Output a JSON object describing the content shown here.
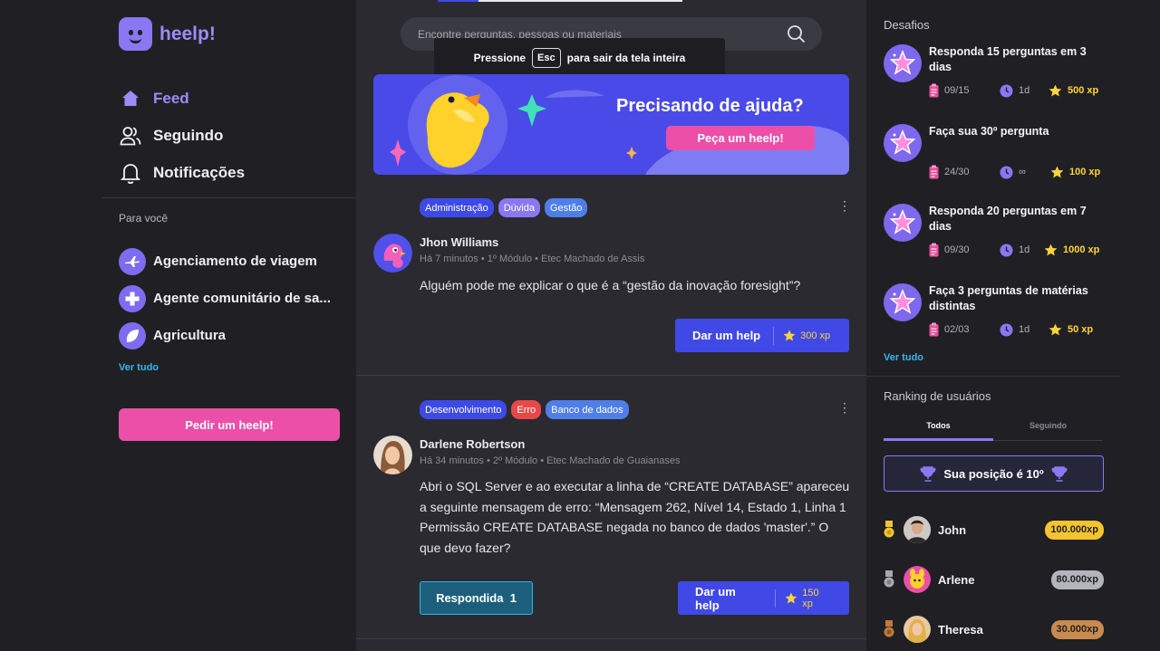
{
  "app": {
    "logo_text": "heelp!"
  },
  "nav": [
    {
      "label": "Feed",
      "icon": "home-icon",
      "active": true
    },
    {
      "label": "Seguindo",
      "icon": "users-icon",
      "active": false
    },
    {
      "label": "Notificações",
      "icon": "bell-icon",
      "active": false
    }
  ],
  "for_you": {
    "title": "Para você",
    "topics": [
      {
        "label": "Agenciamento de viagem",
        "icon": "airplane-icon"
      },
      {
        "label": "Agente comunitário de sa...",
        "icon": "health-cross-icon"
      },
      {
        "label": "Agricultura",
        "icon": "leaf-icon"
      }
    ],
    "see_all": "Ver tudo"
  },
  "ask_button": "Pedir um heelp!",
  "search": {
    "placeholder": "Encontre perguntas, pessoas ou materiais"
  },
  "fullscreen_toast": {
    "before": "Pressione",
    "key": "Esc",
    "after": "para sair da tela inteira"
  },
  "banner": {
    "title": "Precisando de ajuda?",
    "button": "Peça um heelp!"
  },
  "posts": [
    {
      "tags": [
        {
          "label": "Administração",
          "color": "#3d4ae8"
        },
        {
          "label": "Dúvida",
          "color": "#8a78f2"
        },
        {
          "label": "Gestão",
          "color": "#4f7ee8"
        }
      ],
      "author": "Jhon Williams",
      "meta": "Há 7 minutos • 1º Módulo • Etec Machado de Assis",
      "body": "Alguém pode me explicar o que é a “gestão da inovação foresight”?",
      "help_label": "Dar um help",
      "xp": "300 xp"
    },
    {
      "tags": [
        {
          "label": "Desenvolvimento",
          "color": "#3d4ae8"
        },
        {
          "label": "Erro",
          "color": "#e84848"
        },
        {
          "label": "Banco de dados",
          "color": "#4f7ee8"
        }
      ],
      "author": "Darlene Robertson",
      "meta": "Há 34 minutos • 2º Módulo • Etec Machado de Guaianases",
      "body": "Abri o SQL Server e ao executar a linha de “CREATE DATABASE” apareceu a seguinte mensagem de erro:  “Mensagem 262, Nível 14, Estado 1, Linha 1 Permissão CREATE DATABASE negada no banco de dados 'master'.” O que devo fazer?",
      "answered_label": "Respondida",
      "answered_count": "1",
      "help_label": "Dar um help",
      "xp": "150 xp"
    }
  ],
  "challenges": {
    "title": "Desafios",
    "items": [
      {
        "name": "Responda 15 perguntas em 3 dias",
        "progress": "09/15",
        "time": "1d",
        "xp": "500 xp"
      },
      {
        "name": "Faça sua 30º pergunta",
        "progress": "24/30",
        "time": "∞",
        "xp": "100 xp"
      },
      {
        "name": "Responda 20 perguntas em 7 dias",
        "progress": "09/30",
        "time": "1d",
        "xp": "1000 xp"
      },
      {
        "name": "Faça 3 perguntas de matérias distintas",
        "progress": "02/03",
        "time": "1d",
        "xp": "50 xp"
      }
    ],
    "see_all": "Ver tudo"
  },
  "ranking": {
    "title": "Ranking de usuários",
    "tabs": [
      "Todos",
      "Seguindo"
    ],
    "position": "Sua posição é 10º",
    "users": [
      {
        "name": "John",
        "xp": "100.000xp",
        "medal_color": "#f4c430",
        "badge_color": "#f4c430"
      },
      {
        "name": "Arlene",
        "xp": "80.000xp",
        "medal_color": "#a8a8b0",
        "badge_color": "#b4b4bc"
      },
      {
        "name": "Theresa",
        "xp": "30.000xp",
        "medal_color": "#c07a3a",
        "badge_color": "#c98a4e"
      }
    ]
  }
}
